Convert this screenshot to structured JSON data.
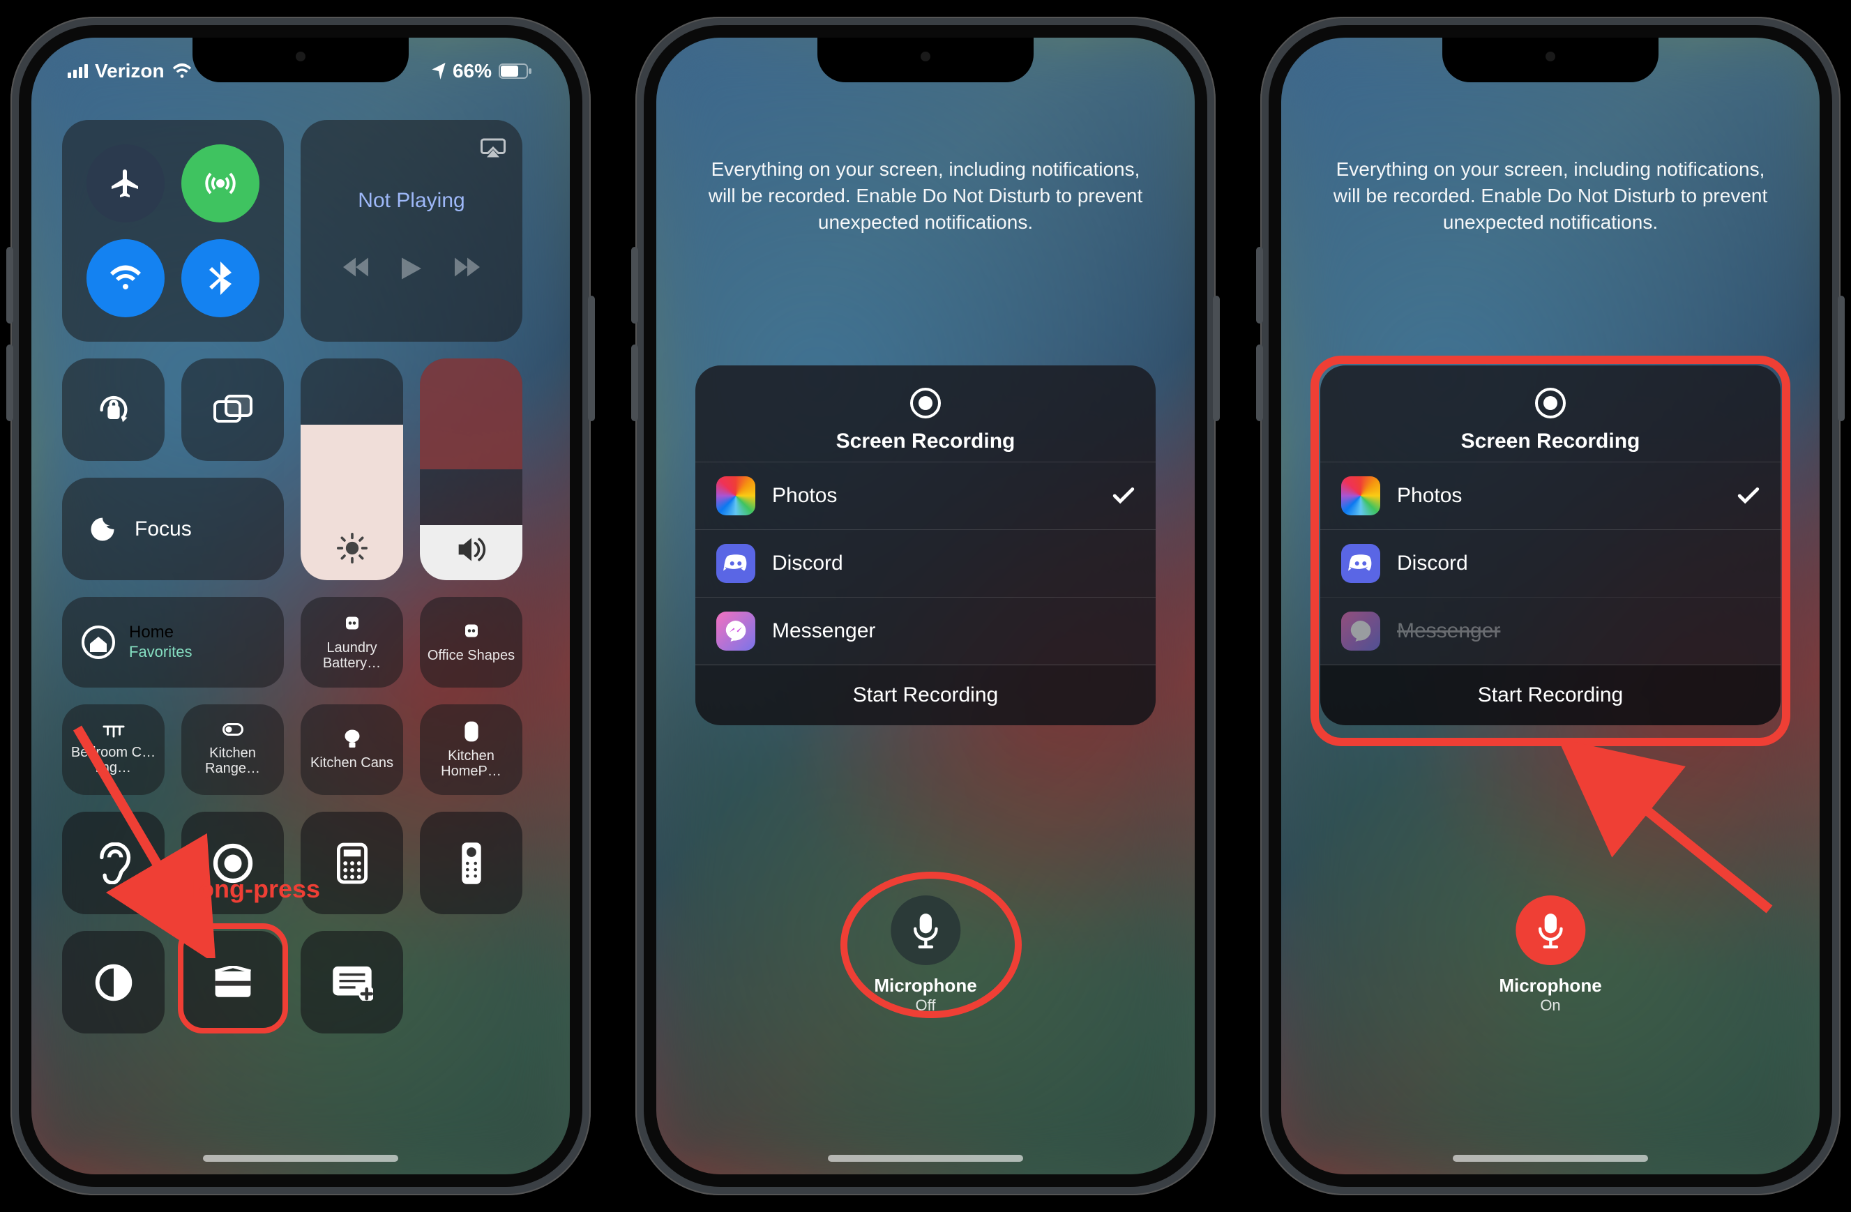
{
  "statusbar": {
    "carrier": "Verizon",
    "battery_pct": "66%"
  },
  "control_center": {
    "not_playing": "Not Playing",
    "focus_label": "Focus",
    "home_label": "Home",
    "home_sub": "Favorites",
    "shortcuts": {
      "laundry": "Laundry Battery…",
      "office": "Office Shapes",
      "bedroom": "Bedroom C…ling…",
      "range": "Kitchen Range…",
      "cans": "Kitchen Cans",
      "homepod": "Kitchen HomeP…"
    }
  },
  "annotations": {
    "long_press": "long-press"
  },
  "recording": {
    "header": "Everything on your screen, including notifications, will be recorded. Enable Do Not Disturb to prevent unexpected notifications.",
    "title": "Screen Recording",
    "apps": {
      "photos": "Photos",
      "discord": "Discord",
      "messenger": "Messenger"
    },
    "start": "Start Recording",
    "mic_label": "Microphone",
    "mic_off": "Off",
    "mic_on": "On"
  }
}
